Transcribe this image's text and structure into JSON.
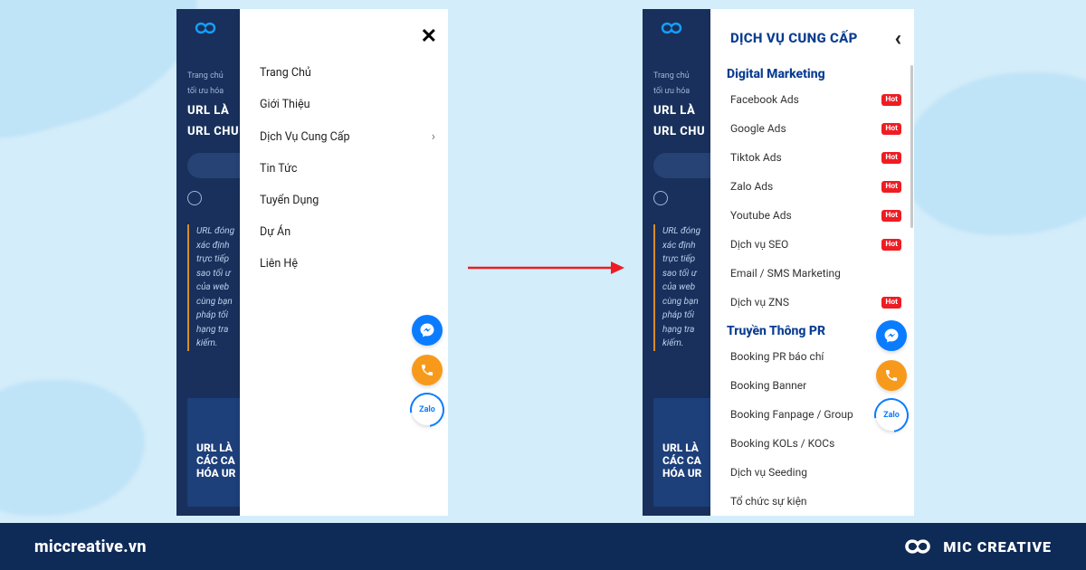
{
  "footer": {
    "site": "miccreative.vn",
    "brand": "MIC CREATIVE"
  },
  "background_page": {
    "breadcrumb_line1": "Trang chủ",
    "breadcrumb_line2": "tối ưu hóa",
    "title_line1": "URL LÀ",
    "title_line2": "URL CHU",
    "quote": "URL đóng\nxác định\ntrực tiếp\nsao tối ư\ncủa web\ncùng bạn\npháp tối\nhạng tra\nkiếm.",
    "card_title_line1": "URL LÀ",
    "card_title_line2": "CÁC CA",
    "card_title_line3": "HÓA UR"
  },
  "main_menu": {
    "items": [
      {
        "label": "Trang Chủ",
        "has_children": false
      },
      {
        "label": "Giới Thiệu",
        "has_children": false
      },
      {
        "label": "Dịch Vụ Cung Cấp",
        "has_children": true
      },
      {
        "label": "Tin Tức",
        "has_children": false
      },
      {
        "label": "Tuyển Dụng",
        "has_children": false
      },
      {
        "label": "Dự Án",
        "has_children": false
      },
      {
        "label": "Liên Hệ",
        "has_children": false
      }
    ]
  },
  "submenu": {
    "title": "DỊCH VỤ CUNG CẤP",
    "sections": [
      {
        "heading": "Digital Marketing",
        "items": [
          {
            "label": "Facebook Ads",
            "hot": true
          },
          {
            "label": "Google Ads",
            "hot": true
          },
          {
            "label": "Tiktok Ads",
            "hot": true
          },
          {
            "label": "Zalo Ads",
            "hot": true
          },
          {
            "label": "Youtube Ads",
            "hot": true
          },
          {
            "label": "Dịch vụ SEO",
            "hot": true
          },
          {
            "label": "Email / SMS Marketing",
            "hot": false
          },
          {
            "label": "Dịch vụ ZNS",
            "hot": true
          }
        ]
      },
      {
        "heading": "Truyền Thông PR",
        "items": [
          {
            "label": "Booking PR báo chí",
            "hot": false
          },
          {
            "label": "Booking Banner",
            "hot": false
          },
          {
            "label": "Booking Fanpage / Group",
            "hot": false
          },
          {
            "label": "Booking KOLs / KOCs",
            "hot": false
          },
          {
            "label": "Dịch vụ Seeding",
            "hot": false
          },
          {
            "label": "Tổ chức sự kiện",
            "hot": false
          }
        ]
      }
    ]
  },
  "badges": {
    "hot": "Hot"
  },
  "contact_bubbles": {
    "zalo": "Zalo"
  },
  "colors": {
    "accent": "#0e2a57",
    "hot": "#ef1c23",
    "messenger": "#0a7cff",
    "phone": "#f79a1b"
  }
}
